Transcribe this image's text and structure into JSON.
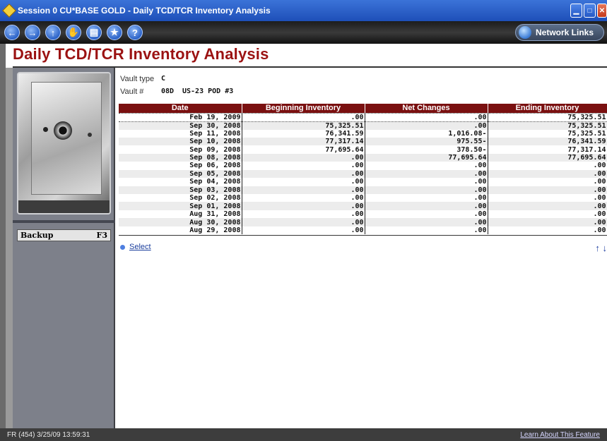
{
  "window": {
    "title": "Session 0 CU*BASE GOLD - Daily TCD/TCR Inventory Analysis",
    "buttons": [
      "minimize",
      "maximize",
      "close"
    ]
  },
  "toolbar": {
    "buttons": [
      {
        "name": "back",
        "glyph": "←"
      },
      {
        "name": "forward",
        "glyph": "→"
      },
      {
        "name": "up",
        "glyph": "↑"
      },
      {
        "name": "stop",
        "glyph": "✋"
      },
      {
        "name": "print",
        "glyph": "▤"
      },
      {
        "name": "favorites",
        "glyph": "★"
      },
      {
        "name": "help",
        "glyph": "?"
      }
    ],
    "network_links": "Network Links"
  },
  "page": {
    "title": "Daily TCD/TCR Inventory Analysis",
    "vault_type_label": "Vault type",
    "vault_type_value": "C",
    "vault_num_label": "Vault #",
    "vault_num_value": "08D",
    "vault_desc": "US-23 POD #3"
  },
  "side": {
    "backup_label": "Backup",
    "backup_key": "F3"
  },
  "table": {
    "headers": [
      "Date",
      "Beginning Inventory",
      "Net Changes",
      "Ending Inventory"
    ],
    "rows": [
      [
        "Feb 19, 2009",
        ".00",
        ".00",
        "75,325.51"
      ],
      [
        "Sep 30, 2008",
        "75,325.51",
        ".00",
        "75,325.51"
      ],
      [
        "Sep 11, 2008",
        "76,341.59",
        "1,016.08-",
        "75,325.51"
      ],
      [
        "Sep 10, 2008",
        "77,317.14",
        "975.55-",
        "76,341.59"
      ],
      [
        "Sep 09, 2008",
        "77,695.64",
        "378.50-",
        "77,317.14"
      ],
      [
        "Sep 08, 2008",
        ".00",
        "77,695.64",
        "77,695.64"
      ],
      [
        "Sep 06, 2008",
        ".00",
        ".00",
        ".00"
      ],
      [
        "Sep 05, 2008",
        ".00",
        ".00",
        ".00"
      ],
      [
        "Sep 04, 2008",
        ".00",
        ".00",
        ".00"
      ],
      [
        "Sep 03, 2008",
        ".00",
        ".00",
        ".00"
      ],
      [
        "Sep 02, 2008",
        ".00",
        ".00",
        ".00"
      ],
      [
        "Sep 01, 2008",
        ".00",
        ".00",
        ".00"
      ],
      [
        "Aug 31, 2008",
        ".00",
        ".00",
        ".00"
      ],
      [
        "Aug 30, 2008",
        ".00",
        ".00",
        ".00"
      ],
      [
        "Aug 29, 2008",
        ".00",
        ".00",
        ".00"
      ]
    ]
  },
  "actions": {
    "select_label": "Select",
    "scroll_arrows": "↑ ↓"
  },
  "status": {
    "left": "FR (454) 3/25/09 13:59:31",
    "right": "Learn About This Feature"
  }
}
